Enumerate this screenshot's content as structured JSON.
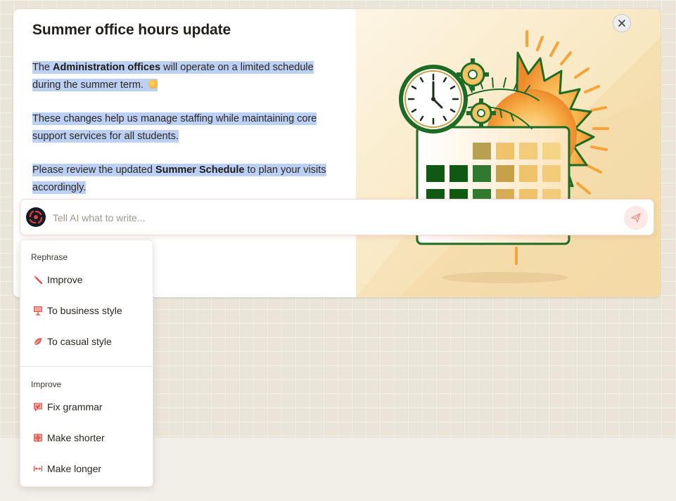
{
  "card": {
    "title": "Summer office hours update",
    "paragraphs": [
      {
        "pre": "The ",
        "bold": "Administration offices",
        "post": " will operate on a limited schedule during the summer term. "
      },
      {
        "text": "These changes help us manage staffing while maintaining core support services for all students."
      },
      {
        "pre": "Please review the updated ",
        "bold": "Summer Schedule",
        "post": " to plan your visits accordingly."
      }
    ],
    "close_icon": "close-icon",
    "illustration_icon": "summer-calendar-clock-illustration"
  },
  "ai_bar": {
    "placeholder": "Tell AI what to write...",
    "avatar_icon": "ai-logo-icon",
    "send_icon": "send-icon"
  },
  "menu": {
    "sections": [
      {
        "label": "Rephrase",
        "items": [
          {
            "label": "Improve",
            "icon": "magic-wand-icon"
          },
          {
            "label": "To business style",
            "icon": "presentation-icon"
          },
          {
            "label": "To casual style",
            "icon": "leaf-icon"
          }
        ]
      },
      {
        "label": "Improve",
        "items": [
          {
            "label": "Fix grammar",
            "icon": "check-chat-icon"
          },
          {
            "label": "Make shorter",
            "icon": "shrink-icon"
          },
          {
            "label": "Make longer",
            "icon": "expand-icon"
          }
        ]
      }
    ]
  },
  "colors": {
    "selection": "#bcd0f5",
    "accent_red": "#d9534f",
    "sun_orange": "#f4a43a",
    "calendar_green": "#1e6b23"
  }
}
